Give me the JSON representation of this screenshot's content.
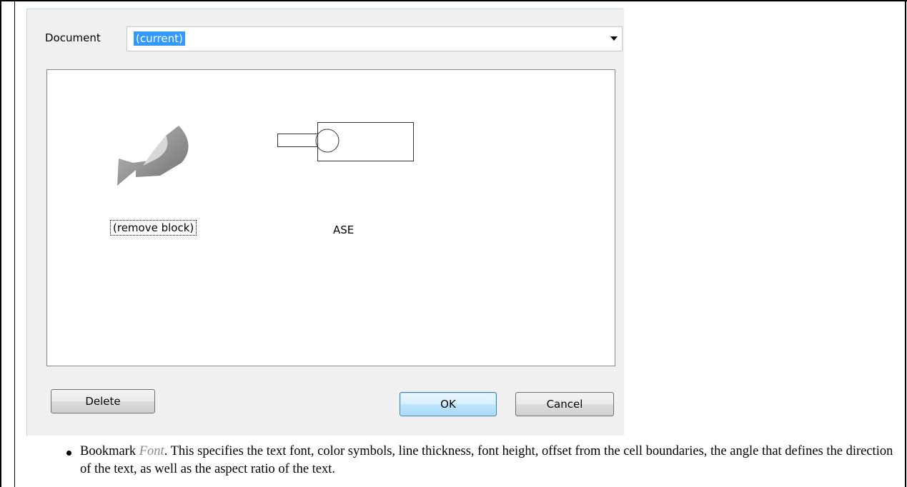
{
  "dialog": {
    "document_label": "Document",
    "document_value": "(current)",
    "blocks": [
      {
        "label": "(remove block)",
        "icon": "remove-block-arrow-icon",
        "focused": true
      },
      {
        "label": "ASE",
        "icon": "ase-block-preview"
      }
    ],
    "buttons": {
      "delete": "Delete",
      "ok": "OK",
      "cancel": "Cancel"
    },
    "colors": {
      "selection": "#3399ff",
      "dialog_bg": "#f0f0f0",
      "default_button_border": "#3c7fb1"
    }
  },
  "bullet": {
    "lead": "Bookmark ",
    "term": "Font",
    "rest": ". This specifies the text font, color symbols, line thickness, font height, offset from the cell boundaries, the angle that defines the direction of the text, as well as the aspect ratio of the text."
  }
}
